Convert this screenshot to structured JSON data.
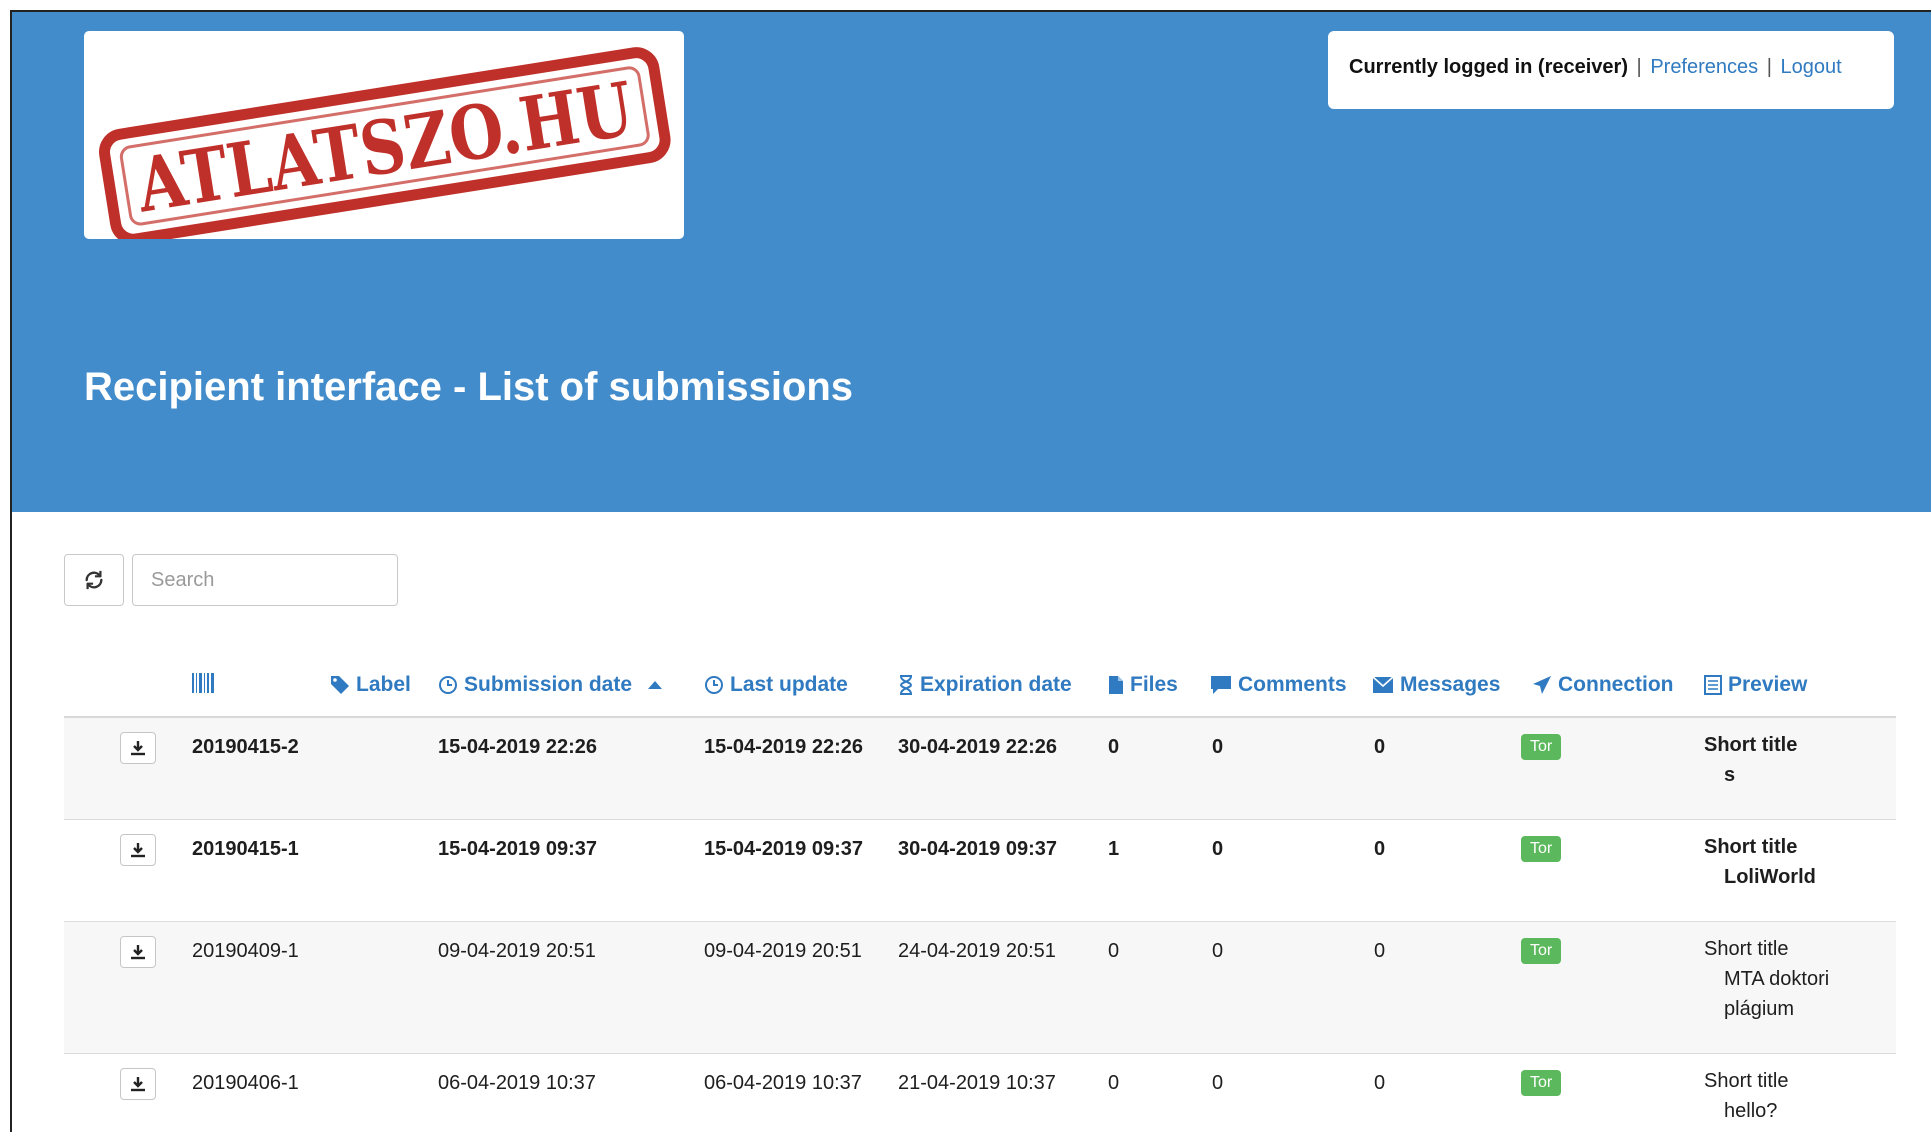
{
  "logo": {
    "text": "ATLATSZO.HU",
    "color": "#c0302a"
  },
  "user_panel": {
    "logged_in_prefix": "Currently logged in (",
    "username": "receiver",
    "logged_in_suffix": ")",
    "separator": "|",
    "preferences_link": "Preferences",
    "logout_link": "Logout"
  },
  "page_title": "Recipient interface - List of submissions",
  "toolbar": {
    "refresh_icon": "refresh-icon",
    "search_placeholder": "Search"
  },
  "table": {
    "columns": [
      {
        "key": "id",
        "label": "",
        "icon": "barcode-icon"
      },
      {
        "key": "label",
        "label": "Label",
        "icon": "tag-icon"
      },
      {
        "key": "submission_date",
        "label": "Submission date",
        "icon": "clock-icon",
        "sorted": "ascending"
      },
      {
        "key": "last_update",
        "label": "Last update",
        "icon": "clock-icon"
      },
      {
        "key": "expiration_date",
        "label": "Expiration date",
        "icon": "hourglass-icon"
      },
      {
        "key": "files",
        "label": "Files",
        "icon": "file-icon"
      },
      {
        "key": "comments",
        "label": "Comments",
        "icon": "comment-icon"
      },
      {
        "key": "messages",
        "label": "Messages",
        "icon": "envelope-icon"
      },
      {
        "key": "connection",
        "label": "Connection",
        "icon": "send-icon"
      },
      {
        "key": "preview",
        "label": "Preview",
        "icon": "list-icon"
      }
    ],
    "rows": [
      {
        "id": "20190415-2",
        "label": "",
        "submission_date": "15-04-2019 22:26",
        "last_update": "15-04-2019 22:26",
        "expiration_date": "30-04-2019 22:26",
        "files": "0",
        "comments": "0",
        "messages": "0",
        "connection": "Tor",
        "preview_title": "Short title",
        "preview_body": "s",
        "unread": true
      },
      {
        "id": "20190415-1",
        "label": "",
        "submission_date": "15-04-2019 09:37",
        "last_update": "15-04-2019 09:37",
        "expiration_date": "30-04-2019 09:37",
        "files": "1",
        "comments": "0",
        "messages": "0",
        "connection": "Tor",
        "preview_title": "Short title",
        "preview_body": "LoliWorld",
        "unread": true
      },
      {
        "id": "20190409-1",
        "label": "",
        "submission_date": "09-04-2019 20:51",
        "last_update": "09-04-2019 20:51",
        "expiration_date": "24-04-2019 20:51",
        "files": "0",
        "comments": "0",
        "messages": "0",
        "connection": "Tor",
        "preview_title": "Short title",
        "preview_body": "MTA doktori plágium",
        "unread": false
      },
      {
        "id": "20190406-1",
        "label": "",
        "submission_date": "06-04-2019 10:37",
        "last_update": "06-04-2019 10:37",
        "expiration_date": "21-04-2019 10:37",
        "files": "0",
        "comments": "0",
        "messages": "0",
        "connection": "Tor",
        "preview_title": "Short title",
        "preview_body": "hello?",
        "unread": false
      }
    ]
  },
  "colors": {
    "banner": "#438ccb",
    "link": "#2f7ac0",
    "tor_badge": "#5cb85c",
    "row_stripe": "#f7f7f7"
  }
}
